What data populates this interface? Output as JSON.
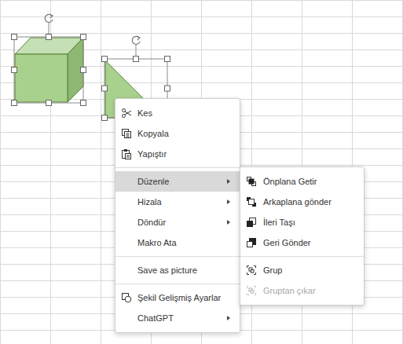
{
  "shapes": [
    {
      "kind": "cube",
      "selected": true
    },
    {
      "kind": "triangle",
      "selected": true
    }
  ],
  "menu": {
    "items": [
      {
        "kind": "item",
        "label": "Kes",
        "selected": false,
        "has_submenu": false
      },
      {
        "kind": "item",
        "label": "Kopyala",
        "selected": false,
        "has_submenu": false
      },
      {
        "kind": "item",
        "label": "Yapıştır",
        "selected": false,
        "has_submenu": false
      },
      {
        "kind": "separator"
      },
      {
        "kind": "item",
        "label": "Düzenle",
        "selected": true,
        "has_submenu": true
      },
      {
        "kind": "item",
        "label": "Hizala",
        "selected": false,
        "has_submenu": true
      },
      {
        "kind": "item",
        "label": "Döndür",
        "selected": false,
        "has_submenu": true
      },
      {
        "kind": "item",
        "label": "Makro Ata",
        "selected": false,
        "has_submenu": false
      },
      {
        "kind": "separator"
      },
      {
        "kind": "item",
        "label": "Save as picture",
        "selected": false,
        "has_submenu": false
      },
      {
        "kind": "separator"
      },
      {
        "kind": "item",
        "label": "Şekil Gelişmiş Ayarlar",
        "selected": false,
        "has_submenu": false
      },
      {
        "kind": "item",
        "label": "ChatGPT",
        "selected": false,
        "has_submenu": true
      }
    ]
  },
  "submenu": {
    "items": [
      {
        "kind": "item",
        "label": "Önplana Getir",
        "disabled": false
      },
      {
        "kind": "item",
        "label": "Arkaplana gönder",
        "disabled": false
      },
      {
        "kind": "item",
        "label": "İleri Taşı",
        "disabled": false
      },
      {
        "kind": "item",
        "label": "Geri Gönder",
        "disabled": false
      },
      {
        "kind": "separator"
      },
      {
        "kind": "item",
        "label": "Grup",
        "disabled": false
      },
      {
        "kind": "item",
        "label": "Gruptan çıkar",
        "disabled": true
      }
    ]
  }
}
